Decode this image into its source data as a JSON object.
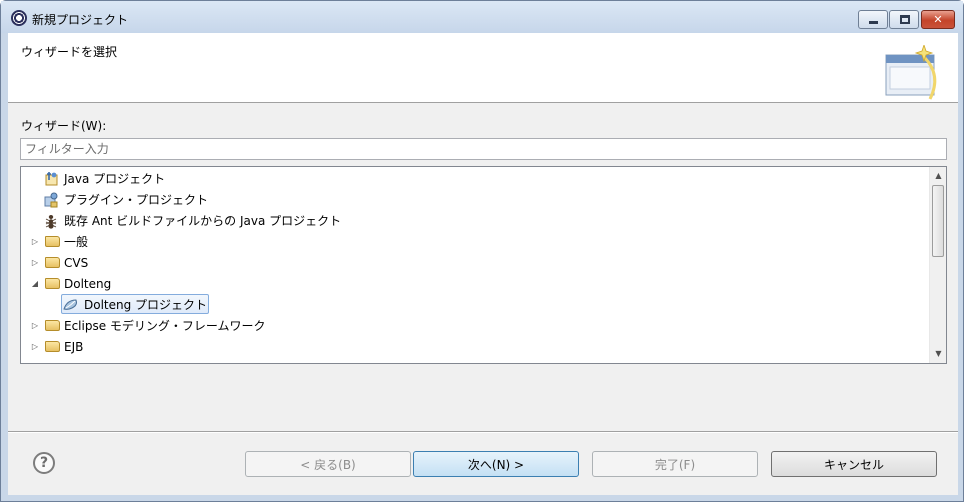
{
  "window": {
    "title": "新規プロジェクト",
    "minimize_glyph": "─",
    "maximize_glyph": "□",
    "close_glyph": "✕"
  },
  "banner": {
    "title": "ウィザードを選択",
    "image_icon": "wizard-banner-icon"
  },
  "wizard_list": {
    "label": "ウィザード(W):",
    "filter_placeholder": "フィルター入力",
    "items": [
      {
        "label": "Java プロジェクト",
        "icon": "java-project-icon",
        "expander": ""
      },
      {
        "label": "プラグイン・プロジェクト",
        "icon": "plugin-project-icon",
        "expander": ""
      },
      {
        "label": "既存 Ant ビルドファイルからの Java プロジェクト",
        "icon": "ant-icon",
        "expander": ""
      },
      {
        "label": "一般",
        "icon": "folder-icon",
        "expander": "▷"
      },
      {
        "label": "CVS",
        "icon": "folder-icon",
        "expander": "▷"
      },
      {
        "label": "Dolteng",
        "icon": "folder-icon",
        "expander": "◢"
      },
      {
        "label": "Dolteng プロジェクト",
        "icon": "dolteng-project-icon",
        "expander": "",
        "selected": true
      },
      {
        "label": "Eclipse モデリング・フレームワーク",
        "icon": "folder-icon",
        "expander": "▷"
      },
      {
        "label": "EJB",
        "icon": "folder-icon",
        "expander": "▷"
      }
    ]
  },
  "scrollbar": {
    "up_glyph": "▲",
    "down_glyph": "▼"
  },
  "buttons": {
    "help_glyph": "?",
    "back": "< 戻る(B)",
    "next": "次へ(N) >",
    "finish": "完了(F)",
    "cancel": "キャンセル"
  },
  "colors": {
    "selection_border": "#84acdd",
    "default_button_border": "#3c7fb1"
  }
}
